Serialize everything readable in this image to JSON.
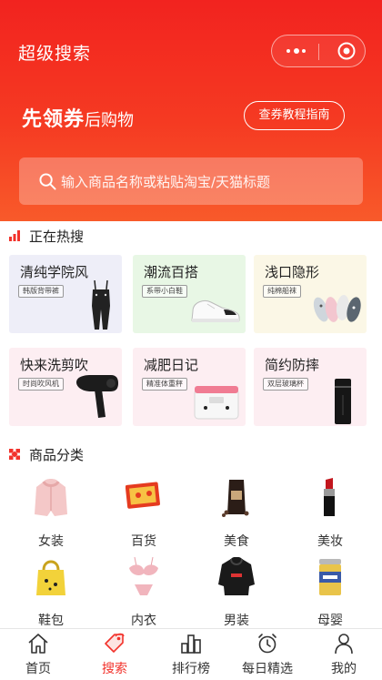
{
  "header": {
    "title": "超级搜索",
    "slogan_strong": "先领券",
    "slogan_rest": "后购物",
    "guide_button": "查券教程指南",
    "search_placeholder": "输入商品名称或粘贴淘宝/天猫标题"
  },
  "hot": {
    "title": "正在热搜",
    "items": [
      {
        "title": "清纯学院风",
        "tag": "韩版背带裤"
      },
      {
        "title": "潮流百搭",
        "tag": "系带小白鞋"
      },
      {
        "title": "浅口隐形",
        "tag": "纯棉船袜"
      },
      {
        "title": "快来洗剪吹",
        "tag": "时尚吹风机"
      },
      {
        "title": "减肥日记",
        "tag": "精准体重秤"
      },
      {
        "title": "简约防摔",
        "tag": "双层玻璃杯"
      }
    ]
  },
  "categories": {
    "title": "商品分类",
    "items": [
      {
        "label": "女装",
        "icon": "coat-icon"
      },
      {
        "label": "百货",
        "icon": "goods-box-icon"
      },
      {
        "label": "美食",
        "icon": "coffee-bag-icon"
      },
      {
        "label": "美妆",
        "icon": "lipstick-icon"
      },
      {
        "label": "鞋包",
        "icon": "tote-bag-icon"
      },
      {
        "label": "内衣",
        "icon": "lingerie-icon"
      },
      {
        "label": "男装",
        "icon": "hoodie-icon"
      },
      {
        "label": "母婴",
        "icon": "formula-can-icon"
      }
    ]
  },
  "tabbar": {
    "items": [
      {
        "label": "首页",
        "icon": "home-icon"
      },
      {
        "label": "搜索",
        "icon": "tag-icon"
      },
      {
        "label": "排行榜",
        "icon": "ranking-icon"
      },
      {
        "label": "每日精选",
        "icon": "alarm-clock-icon"
      },
      {
        "label": "我的",
        "icon": "user-icon"
      }
    ],
    "active": "搜索"
  },
  "colors": {
    "brand_red": "#f2231f",
    "active_tab": "#f2322b",
    "tile_lavender": "#eeeef8",
    "tile_mint": "#e8f7e5",
    "tile_cream": "#fbf7e6",
    "tile_pink": "#fdeef2"
  }
}
